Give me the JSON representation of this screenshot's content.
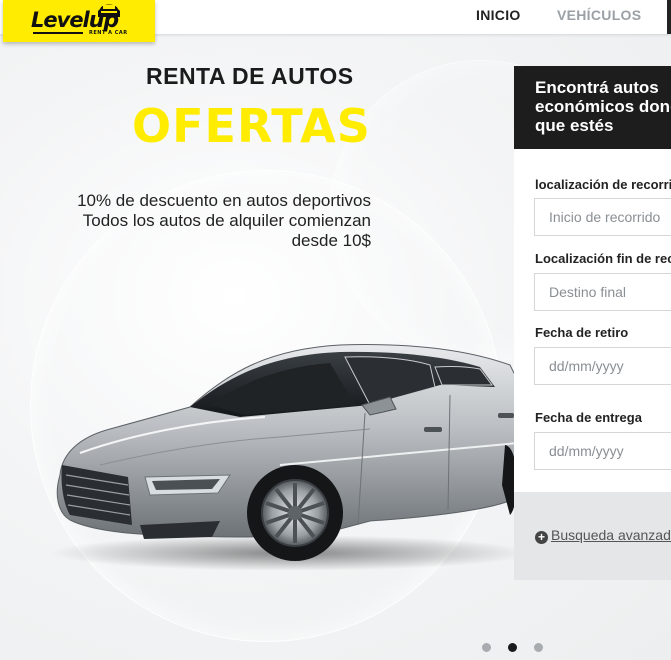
{
  "brand": {
    "logo_main": "Level",
    "logo_up": "up",
    "logo_sub": "RENT A CAR",
    "accent_color": "#ffec00"
  },
  "nav": {
    "items": [
      {
        "label": "INICIO"
      },
      {
        "label": "VEHÍCULOS"
      }
    ]
  },
  "hero": {
    "title": "RENTA DE AUTOS",
    "highlight": "OFERTAS",
    "desc_line1": "10% de descuento en autos deportivos",
    "desc_line2": "Todos los autos de alquiler comienzan",
    "desc_line3": "desde 10$"
  },
  "booking": {
    "heading": "Encontrá autos\neconómicos donde\nque estés",
    "fields": [
      {
        "label": "localización de recorrido",
        "placeholder": "Inicio de recorrido"
      },
      {
        "label": "Localización fin de recorrido",
        "placeholder": "Destino final"
      },
      {
        "label": "Fecha de retiro",
        "placeholder": "dd/mm/yyyy"
      },
      {
        "label": "Fecha de entrega",
        "placeholder": "dd/mm/yyyy"
      }
    ],
    "advanced_link": "Busqueda avanzada"
  },
  "carousel": {
    "slide_count": 3,
    "active_index": 1
  }
}
